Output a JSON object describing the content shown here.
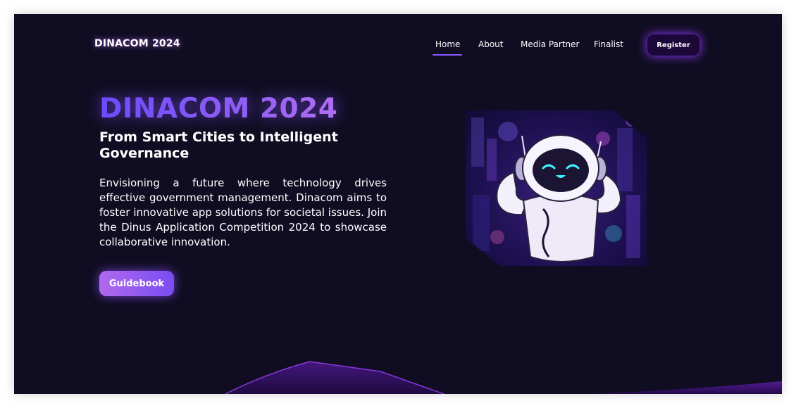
{
  "nav": {
    "logo": "DINACOM 2024",
    "links": [
      "Home",
      "About",
      "Media Partner",
      "Finalist"
    ],
    "register": "Register"
  },
  "hero": {
    "title": "DINACOM 2024",
    "subtitle": "From Smart Cities to Intelligent Governance",
    "description": "Envisioning a future where technology drives effective government management. Dinacom aims to foster innovative app solutions for societal issues. Join the Dinus Application Competition 2024 to showcase collaborative innovation.",
    "cta": "Guidebook"
  },
  "theme": {
    "background": "#100d22",
    "accent": "#8a55ff",
    "gradient_start": "#b069ee",
    "gradient_end": "#7a4cf2"
  },
  "illustration": {
    "icon": "robot-illustration"
  }
}
